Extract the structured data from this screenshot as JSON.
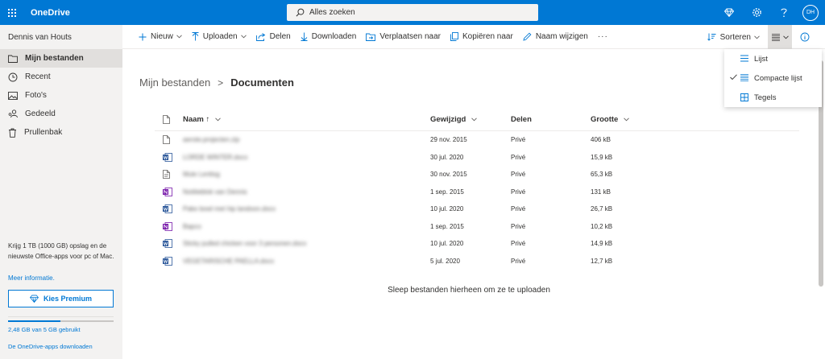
{
  "topbar": {
    "app_name": "OneDrive",
    "search_placeholder": "Alles zoeken",
    "avatar_initials": "DH",
    "brand_color": "#0078d4"
  },
  "sidebar": {
    "user_name": "Dennis van Houts",
    "items": [
      {
        "label": "Mijn bestanden",
        "icon": "folder-icon",
        "active": true
      },
      {
        "label": "Recent",
        "icon": "clock-icon"
      },
      {
        "label": "Foto's",
        "icon": "photo-icon"
      },
      {
        "label": "Gedeeld",
        "icon": "people-icon"
      },
      {
        "label": "Prullenbak",
        "icon": "trash-icon"
      }
    ],
    "promo_text": "Krijg 1 TB (1000 GB) opslag en de nieuwste Office-apps voor pc of Mac.",
    "promo_link": "Meer informatie.",
    "premium_button": "Kies Premium",
    "storage_text": "2,48 GB van 5 GB gebruikt",
    "storage_fraction": 0.496,
    "apps_link": "De OneDrive-apps downloaden"
  },
  "commandbar": {
    "new": "Nieuw",
    "upload": "Uploaden",
    "share": "Delen",
    "download": "Downloaden",
    "move": "Verplaatsen naar",
    "copy": "Kopiëren naar",
    "rename": "Naam wijzigen",
    "more": "···",
    "sort": "Sorteren"
  },
  "view_menu": {
    "items": [
      {
        "label": "Lijst",
        "icon": "list-icon",
        "checked": false
      },
      {
        "label": "Compacte lijst",
        "icon": "compact-list-icon",
        "checked": true
      },
      {
        "label": "Tegels",
        "icon": "tiles-icon",
        "checked": false
      }
    ]
  },
  "breadcrumb": {
    "parent": "Mijn bestanden",
    "separator": ">",
    "current": "Documenten"
  },
  "table": {
    "columns": {
      "name": "Naam ↑",
      "modified": "Gewijzigd",
      "sharing": "Delen",
      "size": "Grootte"
    },
    "rows": [
      {
        "type": "file",
        "name": "aerote.projecten.zip",
        "modified": "29 nov. 2015",
        "sharing": "Privé",
        "size": "406 kB"
      },
      {
        "type": "word",
        "name": "LORDE WINTER.docx",
        "modified": "30 jul. 2020",
        "sharing": "Privé",
        "size": "15,9 kB"
      },
      {
        "type": "text",
        "name": "Mule Lenttsg",
        "modified": "30 nov. 2015",
        "sharing": "Privé",
        "size": "65,3 kB"
      },
      {
        "type": "onenote",
        "name": "Notitieblok van Dennis",
        "modified": "1 sep. 2015",
        "sharing": "Privé",
        "size": "131 kB"
      },
      {
        "type": "word",
        "name": "Pake bowl met hip landoon.docx",
        "modified": "10 jul. 2020",
        "sharing": "Privé",
        "size": "26,7 kB"
      },
      {
        "type": "onenote",
        "name": "Bapco",
        "modified": "1 sep. 2015",
        "sharing": "Privé",
        "size": "10,2 kB"
      },
      {
        "type": "word",
        "name": "Sticky pulled chicken voor 3 personen.docx",
        "modified": "10 jul. 2020",
        "sharing": "Privé",
        "size": "14,9 kB"
      },
      {
        "type": "word",
        "name": "VEGETARISCHE PAELLA.docx",
        "modified": "5 jul. 2020",
        "sharing": "Privé",
        "size": "12,7 kB"
      }
    ],
    "drop_hint": "Sleep bestanden hierheen om ze te uploaden"
  }
}
